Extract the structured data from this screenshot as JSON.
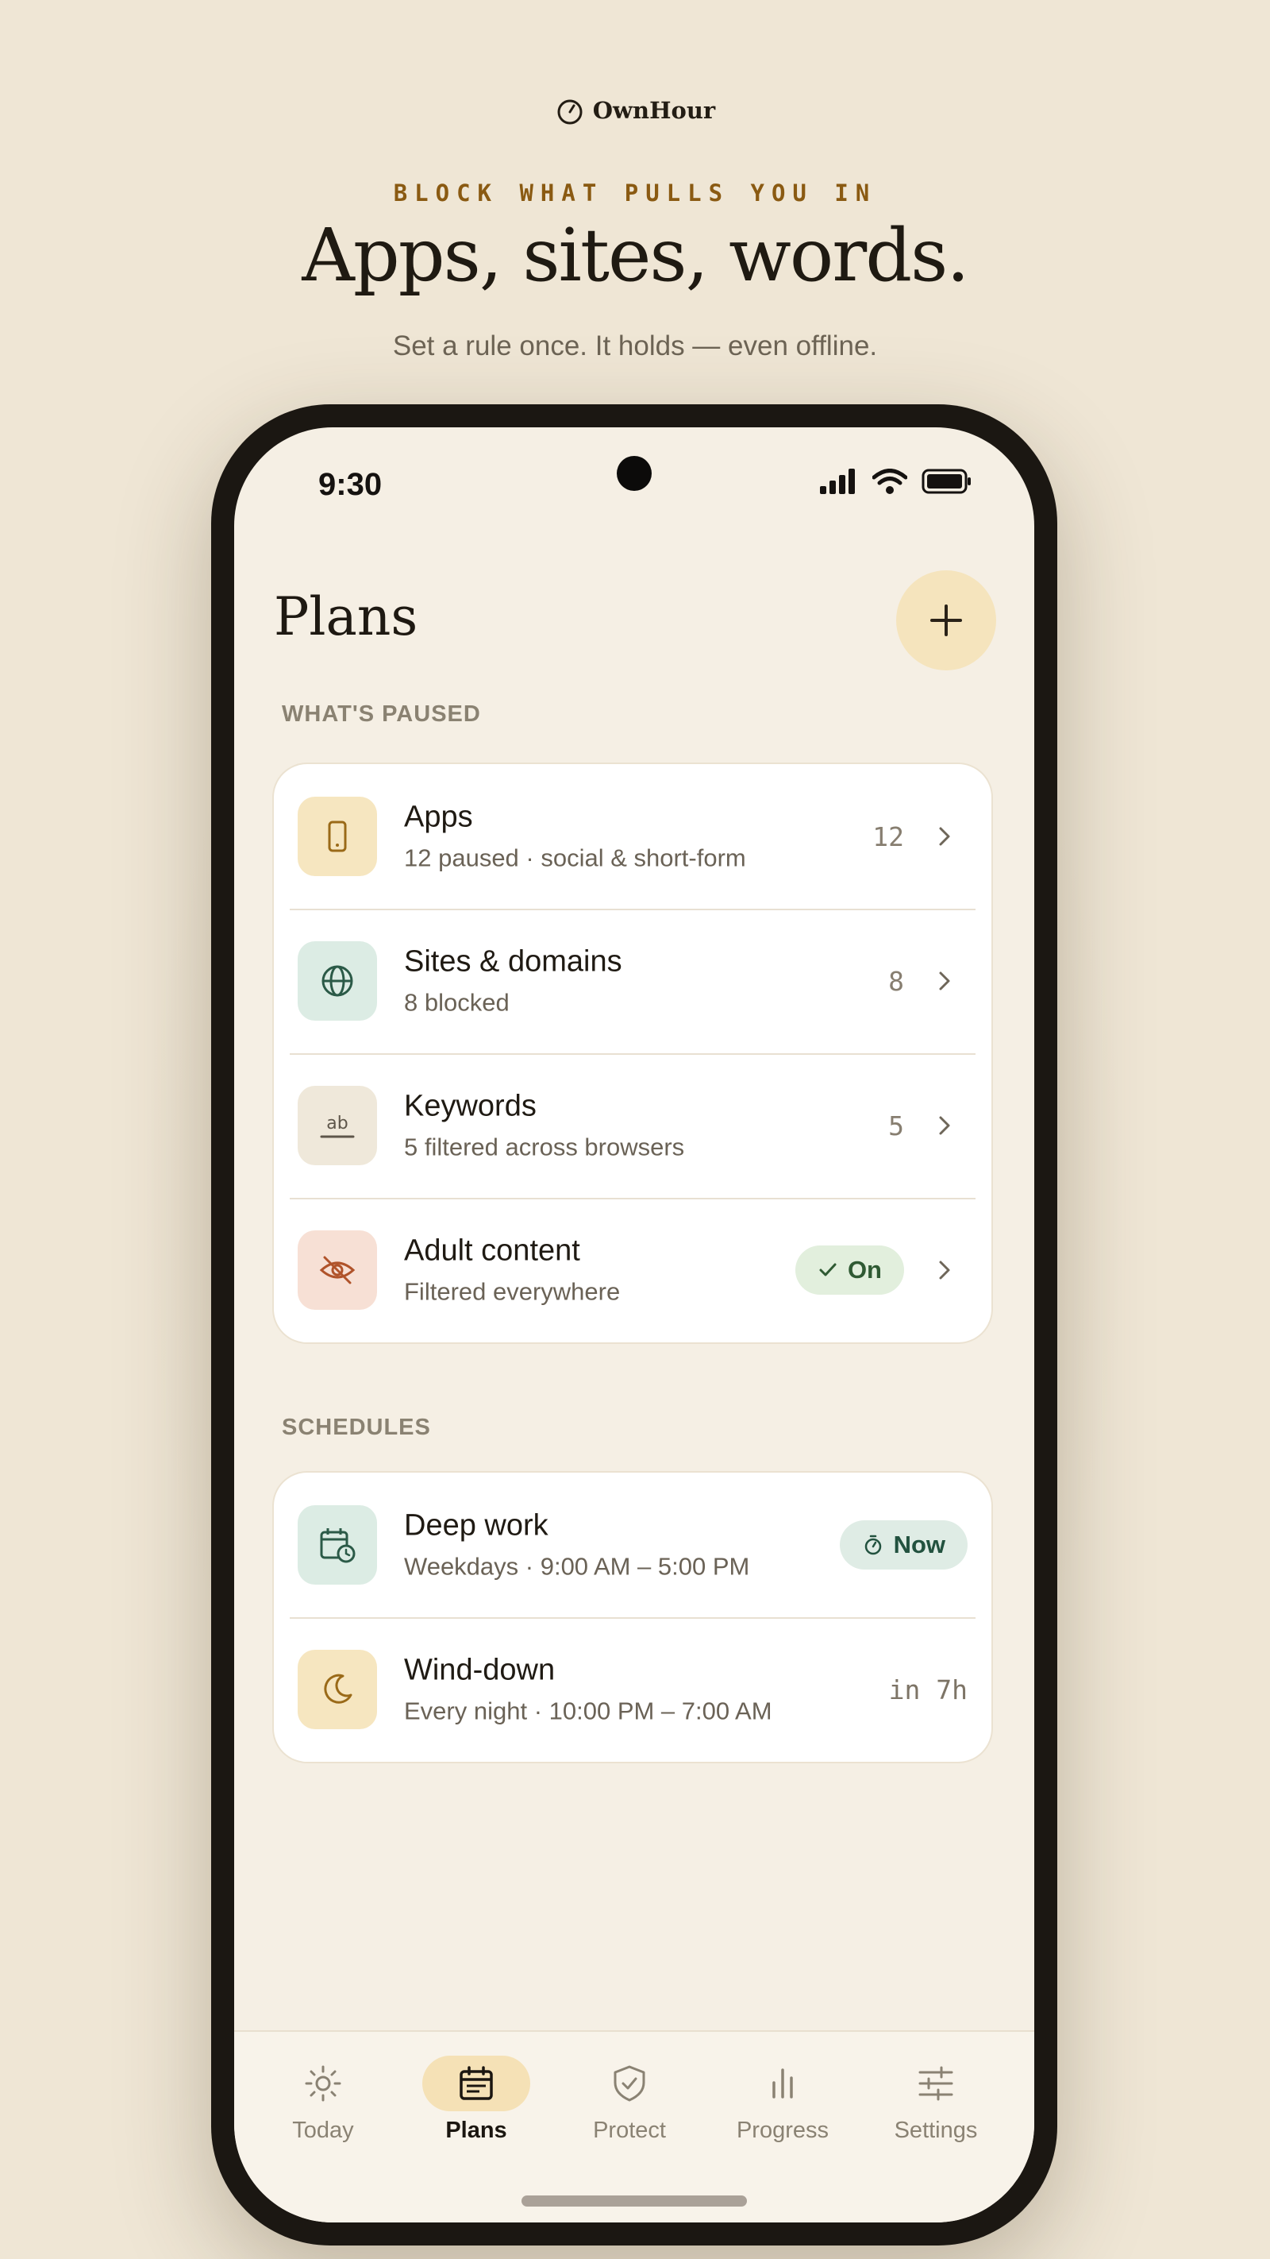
{
  "brand": {
    "name": "OwnHour",
    "icon": "stopwatch-icon"
  },
  "hero": {
    "eyebrow": "BLOCK WHAT PULLS YOU IN",
    "headline": "Apps, sites, words.",
    "subline": "Set a rule once. It holds — even offline."
  },
  "status_bar": {
    "time": "9:30",
    "icons": [
      "signal-icon",
      "wifi-icon",
      "battery-icon"
    ]
  },
  "page": {
    "title": "Plans",
    "add_icon": "plus-icon"
  },
  "whats_paused": {
    "label": "WHAT'S PAUSED",
    "items": [
      {
        "title": "Apps",
        "subtitle": "12 paused · social & short-form",
        "count": "12",
        "icon": "phone-icon",
        "color": "#f6e6c0"
      },
      {
        "title": "Sites & domains",
        "subtitle": "8 blocked",
        "count": "8",
        "icon": "globe-icon",
        "color": "#dcece4"
      },
      {
        "title": "Keywords",
        "subtitle": "5 filtered across browsers",
        "count": "5",
        "icon": "keyword-ab-icon",
        "color": "#efe8da"
      },
      {
        "title": "Adult content",
        "subtitle": "Filtered everywhere",
        "badge": "On",
        "icon": "eye-off-icon",
        "color": "#f7e0d5"
      }
    ]
  },
  "schedules": {
    "label": "SCHEDULES",
    "items": [
      {
        "title": "Deep work",
        "subtitle": "Weekdays · 9:00 AM – 5:00 PM",
        "badge": "Now",
        "icon": "calendar-clock-icon",
        "color": "#dcece4"
      },
      {
        "title": "Wind-down",
        "subtitle": "Every night · 10:00 PM – 7:00 AM",
        "relative_time": "in 7h",
        "icon": "moon-icon",
        "color": "#f6e6c0"
      }
    ]
  },
  "tabs": [
    {
      "label": "Today",
      "icon": "sun-icon",
      "active": false
    },
    {
      "label": "Plans",
      "icon": "calendar-icon",
      "active": true
    },
    {
      "label": "Protect",
      "icon": "shield-check-icon",
      "active": false
    },
    {
      "label": "Progress",
      "icon": "bar-chart-icon",
      "active": false
    },
    {
      "label": "Settings",
      "icon": "sliders-icon",
      "active": false
    }
  ],
  "colors": {
    "background": "#efe6d5",
    "accent": "#8a5a12",
    "screen": "#f5efe4",
    "active_tab": "#f5e1b6"
  }
}
